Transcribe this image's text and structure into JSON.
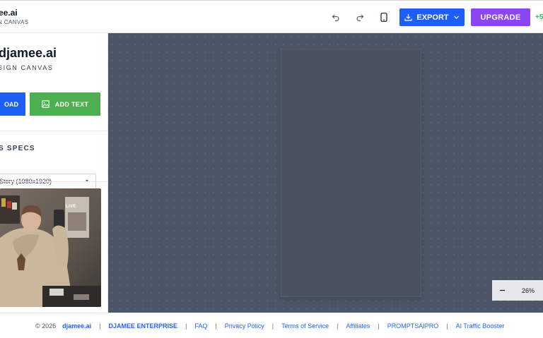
{
  "header": {
    "brand_title": "ee.ai",
    "brand_subtitle": "N CANVAS",
    "export_label": "EXPORT",
    "upgrade_label": "UPGRADE",
    "plus_count": "+5"
  },
  "sidebar": {
    "title": "djamee.ai",
    "subtitle": "SIGN CANVAS",
    "upload_label": "OAD",
    "add_text_label": "ADD TEXT",
    "specs_title": "S SPECS",
    "format_select_value": "Story (1080x1920)",
    "preview_overlay_text": "LIVE"
  },
  "canvas": {
    "zoom_level": "26%"
  },
  "footer": {
    "copyright": "© 2026",
    "brand": "djamee.ai",
    "enterprise": "DJAMEE ENTERPRISE",
    "links": [
      "FAQ",
      "Privacy Policy",
      "Terms of Service",
      "Affiliates",
      "PROMPTSAIPRO",
      "AI Traffic Booster"
    ],
    "separator": "|"
  },
  "colors": {
    "accent_blue": "#1d5ff5",
    "upgrade_purple": "#8b45f2",
    "add_text_green": "#4caf50",
    "canvas_bg": "#4b5565",
    "credit_green": "#22c55e"
  },
  "icons": [
    "undo-icon",
    "redo-icon",
    "mobile-icon",
    "download-icon",
    "chevron-down-icon",
    "image-icon",
    "minus-icon"
  ]
}
